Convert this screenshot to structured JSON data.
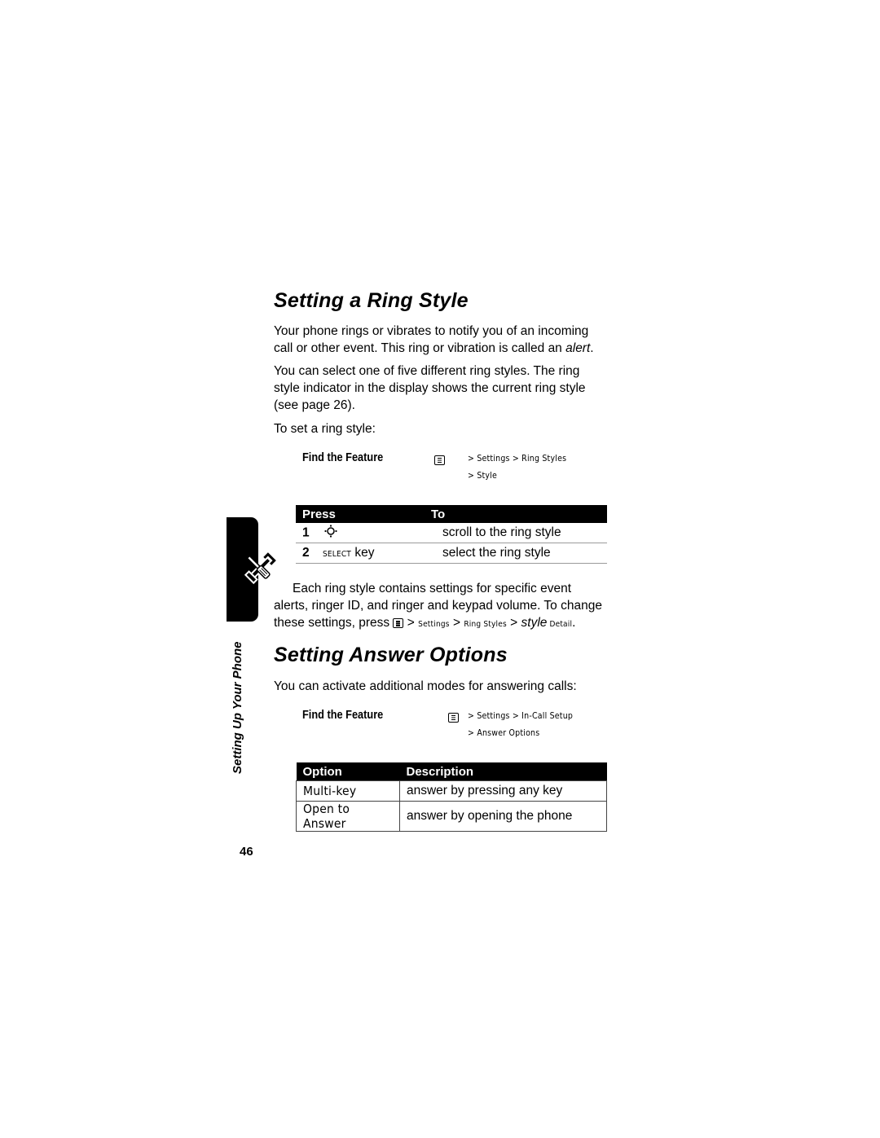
{
  "page_number": "46",
  "side_tab": {
    "label": "Setting Up Your Phone",
    "icon": "wrench-screwdriver-icon"
  },
  "section1": {
    "title": "Setting a Ring Style",
    "para1_before": "Your phone rings or vibrates to notify you of an incoming call or other event. This ring or vibration is called an ",
    "para1_em": "alert",
    "para1_after": ".",
    "para2": "You can select one of five different ring styles. The ring style indicator in the display shows the current ring style (see page 26).",
    "para3": "To set a ring style:",
    "find_feature": {
      "label": "Find the Feature",
      "icon": "menu-key-icon",
      "path_line1": "> Settings > Ring Styles",
      "path_line2": "> Style"
    },
    "press_table": {
      "headers": [
        "Press",
        "To"
      ],
      "rows": [
        {
          "num": "1",
          "key_icon": "navigation-key-icon",
          "key": "",
          "to": "scroll to the ring style"
        },
        {
          "num": "2",
          "key_small": "SELECT",
          "key": " key",
          "to": "select the ring style"
        }
      ]
    },
    "tip_line1": "Each ring style contains settings for specific event",
    "tip_line2": "alerts, ringer ID, and ringer and keypad volume. To change",
    "tip_line3_a": "these settings, press",
    "tip_path_1": " > ",
    "tip_path_settings": "Settings",
    "tip_path_2": " > ",
    "tip_path_ring": "Ring Styles",
    "tip_path_3": " > ",
    "tip_path_style": "style",
    "tip_path_detail": " Detail",
    "tip_end": "."
  },
  "section2": {
    "title": "Setting Answer Options",
    "para1": "You can activate additional modes for answering calls:",
    "find_feature": {
      "label": "Find the Feature",
      "icon": "menu-key-icon",
      "path_line1": "> Settings > In-Call Setup",
      "path_line2": "> Answer Options"
    },
    "options_table": {
      "headers": [
        "Option",
        "Description"
      ],
      "rows": [
        {
          "option": "Multi-key",
          "description": "answer by pressing any key"
        },
        {
          "option": "Open to Answer",
          "description": "answer by opening the phone"
        }
      ]
    }
  }
}
